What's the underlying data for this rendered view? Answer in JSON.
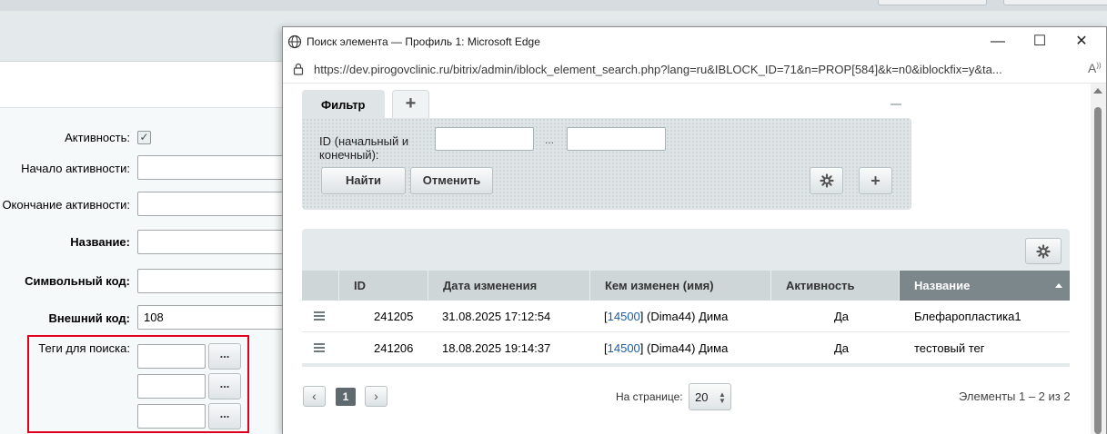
{
  "background_form": {
    "fields": {
      "active_label": "Активность:",
      "start_label": "Начало активности:",
      "end_label": "Окончание активности:",
      "name_label": "Название:",
      "code_label": "Символьный код:",
      "external_code_label": "Внешний код:",
      "external_code_value": "108",
      "tags_label": "Теги для поиска:",
      "dots_label": "..."
    }
  },
  "window": {
    "title": "Поиск элемента — Профиль 1: Microsoft Edge",
    "url": "https://dev.pirogovclinic.ru/bitrix/admin/iblock_element_search.php?lang=ru&IBLOCK_ID=71&n=PROP[584]&k=n0&iblockfix=y&ta...",
    "controls": {
      "minimize": "—",
      "maximize": "☐",
      "close": "✕"
    }
  },
  "filter": {
    "tab_label": "Фильтр",
    "add_tab": "+",
    "id_label_line1": "ID (начальный и",
    "id_label_line2": "конечный):",
    "range_separator": "...",
    "find_button": "Найти",
    "cancel_button": "Отменить",
    "add_button": "+"
  },
  "table": {
    "columns": [
      "ID",
      "Дата изменения",
      "Кем изменен (имя)",
      "Активность",
      "Название"
    ],
    "sorted_column": "Название",
    "rows": [
      {
        "id": "241205",
        "date": "31.08.2025 17:12:54",
        "user_id": "14500",
        "user_rest": "(Dima44) Дима",
        "active": "Да",
        "name": "Блефаропластика1"
      },
      {
        "id": "241206",
        "date": "18.08.2025 19:14:37",
        "user_id": "14500",
        "user_rest": "(Dima44) Дима",
        "active": "Да",
        "name": "тестовый тег"
      }
    ]
  },
  "pagination": {
    "prev": "‹",
    "current_page": "1",
    "next": "›",
    "per_page_label": "На странице:",
    "per_page_value": "20",
    "elements_count": "Элементы 1 – 2 из 2"
  },
  "colors": {
    "highlight_box": "#e0001b",
    "link": "#1a5ea8",
    "sorted_header": "#7c878c"
  }
}
